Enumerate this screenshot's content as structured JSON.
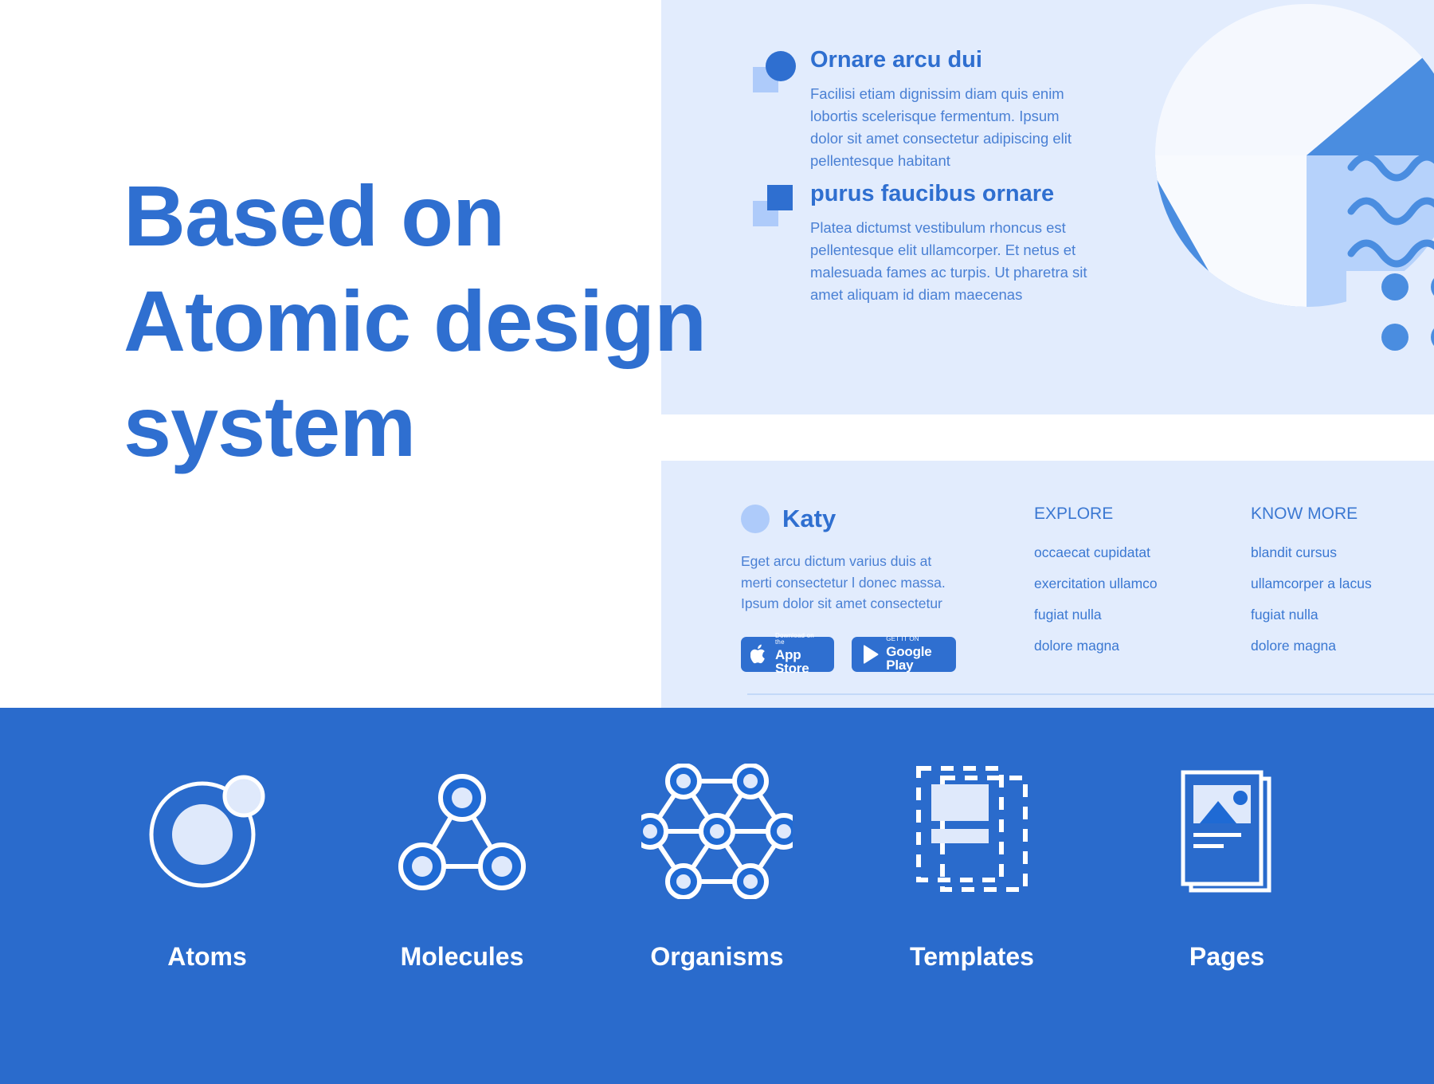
{
  "headline": "Based on\nAtomic design\nsystem",
  "colors": {
    "primary_blue": "#2f6fd0",
    "band_blue": "#2a6bcc",
    "panel_bg": "#e2ecfd",
    "light_blue": "#aecbfa",
    "pale": "#f5f8fe",
    "text_blue": "#4a80d4",
    "white": "#ffffff"
  },
  "features": [
    {
      "title": "Ornare arcu dui",
      "body": "Facilisi etiam dignissim diam quis enim lobortis scelerisque fermentum. Ipsum dolor sit amet consectetur adipiscing elit pellentesque habitant",
      "marker": "circle-on-square-marker"
    },
    {
      "title": "purus faucibus ornare",
      "body": "Platea dictumst vestibulum rhoncus est pellentesque elit ullamcorper. Et netus et malesuada fames ac turpis. Ut pharetra sit amet aliquam id diam maecenas",
      "marker": "square-on-square-marker"
    }
  ],
  "footer": {
    "brand": {
      "name": "Katy",
      "description": "Eget arcu dictum varius duis at merti consectetur l donec massa. Ipsum dolor sit amet consectetur"
    },
    "stores": [
      {
        "icon": "apple-logo-icon",
        "small": "Download on the",
        "big": "App Store"
      },
      {
        "icon": "google-play-icon",
        "small": "GET IT ON",
        "big": "Google Play"
      }
    ],
    "columns": [
      {
        "heading": "EXPLORE",
        "links": [
          "occaecat cupidatat",
          "exercitation ullamco",
          "fugiat nulla",
          "dolore magna"
        ]
      },
      {
        "heading": "KNOW MORE",
        "links": [
          "blandit cursus",
          "ullamcorper a lacus",
          "fugiat nulla",
          "dolore magna"
        ]
      }
    ]
  },
  "band": {
    "items": [
      {
        "label": "Atoms",
        "icon": "atom-icon"
      },
      {
        "label": "Molecules",
        "icon": "molecule-triangle-icon"
      },
      {
        "label": "Organisms",
        "icon": "organism-hexagon-icon"
      },
      {
        "label": "Templates",
        "icon": "template-frames-icon"
      },
      {
        "label": "Pages",
        "icon": "pages-document-icon"
      }
    ]
  }
}
